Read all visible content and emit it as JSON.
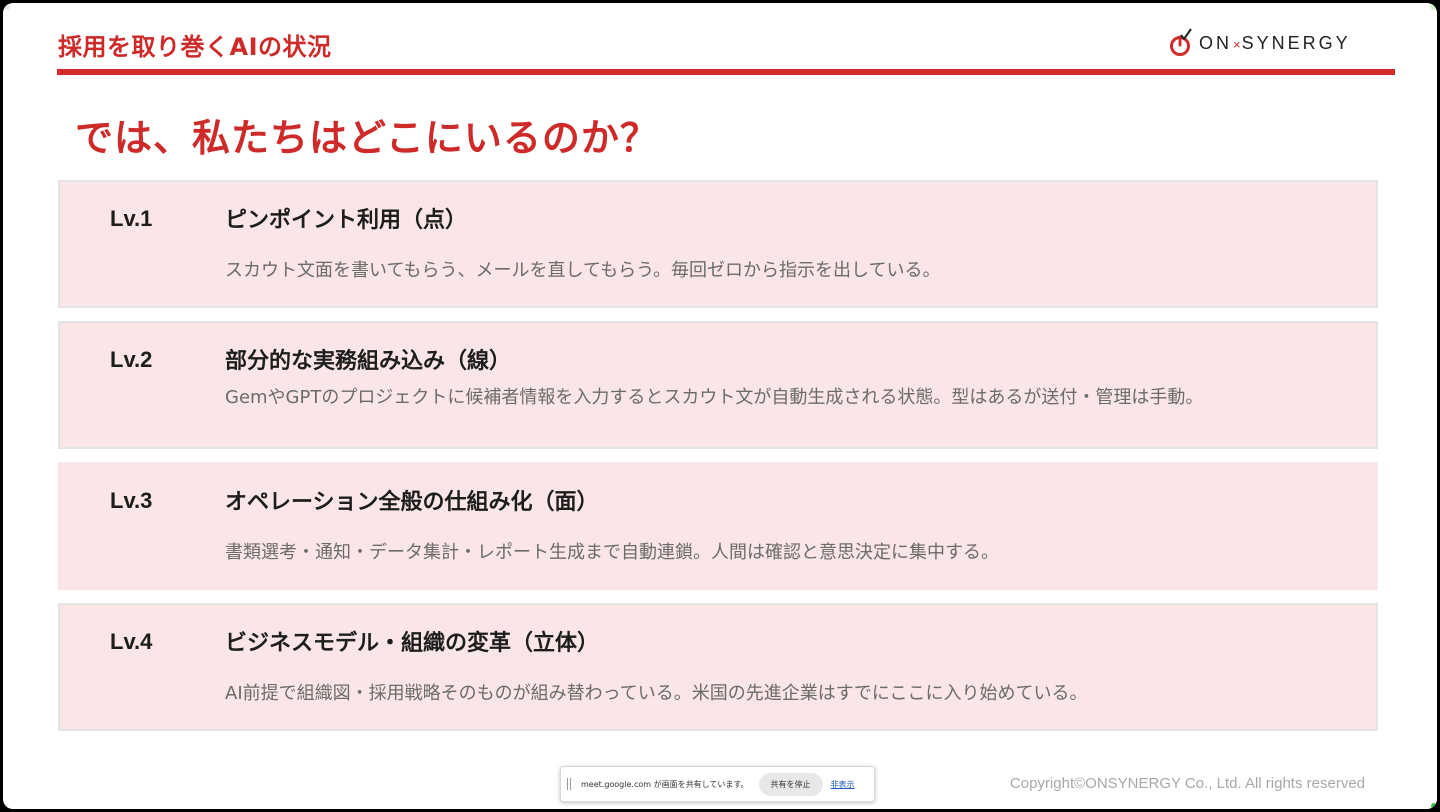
{
  "slide": {
    "section_title": "採用を取り巻くAIの状況",
    "headline": "では、私たちはどこにいるのか？",
    "copyright": "Copyright©ONSYNERGY Co., Ltd. All rights reserved"
  },
  "logo": {
    "left": "ON",
    "separator": "×",
    "right": "SYNERGY",
    "colors": {
      "accent": "#d12b2b",
      "text": "#222222"
    }
  },
  "levels": [
    {
      "label": "Lv.1",
      "heading": "ピンポイント利用（点）",
      "description": "スカウト文面を書いてもらう、メールを直してもらう。毎回ゼロから指示を出している。"
    },
    {
      "label": "Lv.2",
      "heading": "部分的な実務組み込み（線）",
      "description": "GemやGPTのプロジェクトに候補者情報を入力するとスカウト文が自動生成される状態。型はあるが送付・管理は手動。"
    },
    {
      "label": "Lv.3",
      "heading": "オペレーション全般の仕組み化（面）",
      "description": "書類選考・通知・データ集計・レポート生成まで自動連鎖。人間は確認と意思決定に集中する。"
    },
    {
      "label": "Lv.4",
      "heading": "ビジネスモデル・組織の変革（立体）",
      "description": "AI前提で組織図・採用戦略そのものが組み替わっている。米国の先進企業はすでにここに入り始めている。"
    }
  ],
  "share_bar": {
    "message": "meet.google.com が画面を共有しています。",
    "stop_label": "共有を停止",
    "hide_label": "非表示"
  },
  "colors": {
    "brand_red": "#cf2a2a",
    "card_bg": "#fbe6e7",
    "body_text": "#6b6b6b"
  }
}
